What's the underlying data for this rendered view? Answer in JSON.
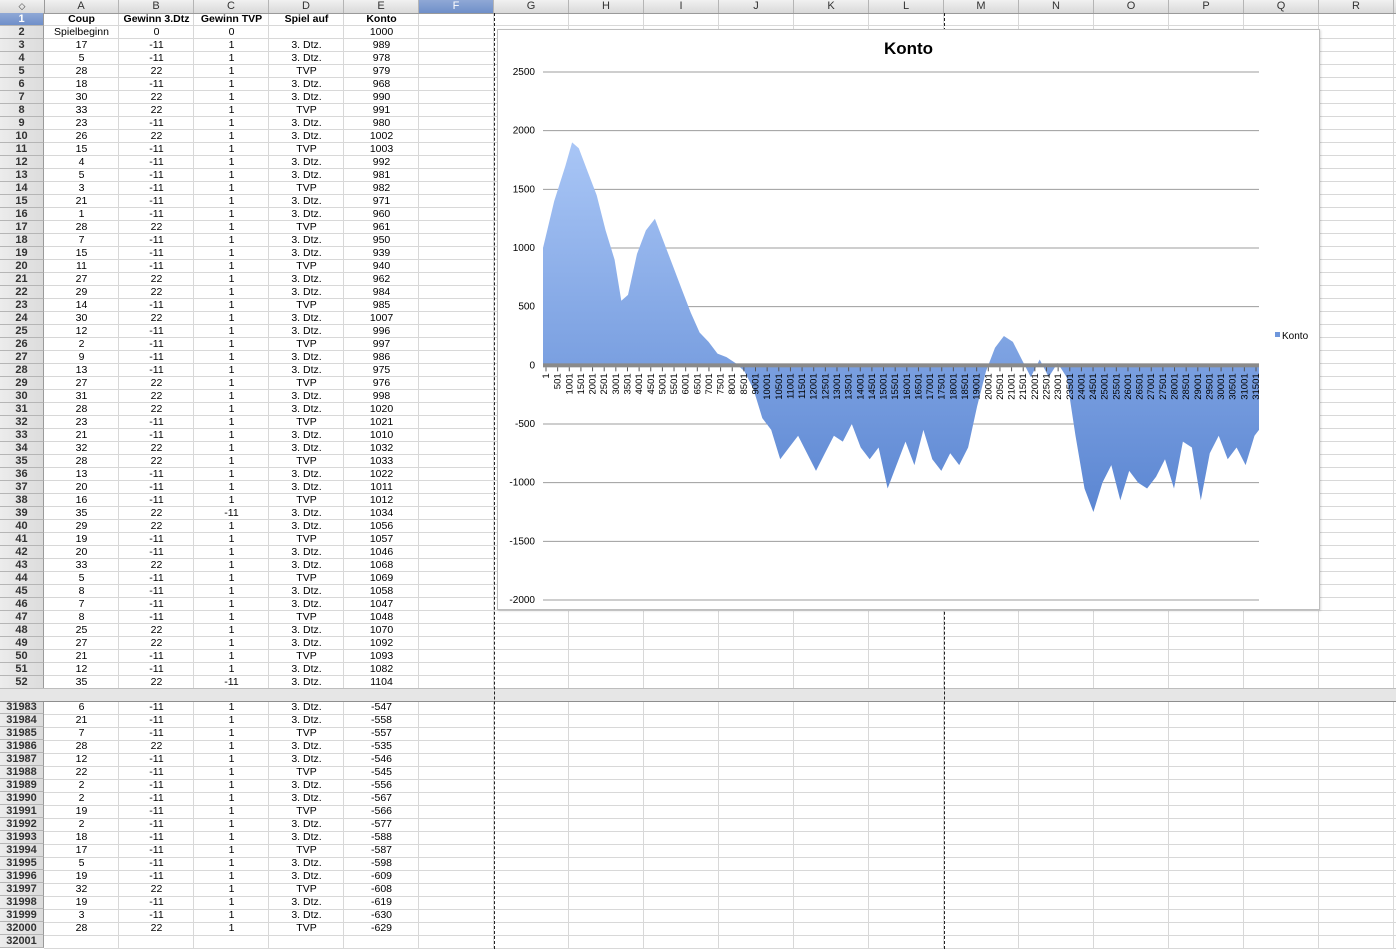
{
  "corner_symbol": "◇",
  "columns": [
    "A",
    "B",
    "C",
    "D",
    "E",
    "F",
    "G",
    "H",
    "I",
    "J",
    "K",
    "L",
    "M",
    "N",
    "O",
    "P",
    "Q",
    "R"
  ],
  "selected_column": "F",
  "header_row": {
    "row": "1",
    "cells": [
      "Coup",
      "Gewinn 3.Dtz",
      "Gewinn TVP",
      "Spiel auf",
      "Konto"
    ]
  },
  "rows_top": [
    {
      "row": "2",
      "cells": [
        "Spielbeginn",
        "0",
        "0",
        "",
        "1000"
      ]
    },
    {
      "row": "3",
      "cells": [
        "17",
        "-11",
        "1",
        "3. Dtz.",
        "989"
      ]
    },
    {
      "row": "4",
      "cells": [
        "5",
        "-11",
        "1",
        "3. Dtz.",
        "978"
      ]
    },
    {
      "row": "5",
      "cells": [
        "28",
        "22",
        "1",
        "TVP",
        "979"
      ]
    },
    {
      "row": "6",
      "cells": [
        "18",
        "-11",
        "1",
        "3. Dtz.",
        "968"
      ]
    },
    {
      "row": "7",
      "cells": [
        "30",
        "22",
        "1",
        "3. Dtz.",
        "990"
      ]
    },
    {
      "row": "8",
      "cells": [
        "33",
        "22",
        "1",
        "TVP",
        "991"
      ]
    },
    {
      "row": "9",
      "cells": [
        "23",
        "-11",
        "1",
        "3. Dtz.",
        "980"
      ]
    },
    {
      "row": "10",
      "cells": [
        "26",
        "22",
        "1",
        "3. Dtz.",
        "1002"
      ]
    },
    {
      "row": "11",
      "cells": [
        "15",
        "-11",
        "1",
        "TVP",
        "1003"
      ]
    },
    {
      "row": "12",
      "cells": [
        "4",
        "-11",
        "1",
        "3. Dtz.",
        "992"
      ]
    },
    {
      "row": "13",
      "cells": [
        "5",
        "-11",
        "1",
        "3. Dtz.",
        "981"
      ]
    },
    {
      "row": "14",
      "cells": [
        "3",
        "-11",
        "1",
        "TVP",
        "982"
      ]
    },
    {
      "row": "15",
      "cells": [
        "21",
        "-11",
        "1",
        "3. Dtz.",
        "971"
      ]
    },
    {
      "row": "16",
      "cells": [
        "1",
        "-11",
        "1",
        "3. Dtz.",
        "960"
      ]
    },
    {
      "row": "17",
      "cells": [
        "28",
        "22",
        "1",
        "TVP",
        "961"
      ]
    },
    {
      "row": "18",
      "cells": [
        "7",
        "-11",
        "1",
        "3. Dtz.",
        "950"
      ]
    },
    {
      "row": "19",
      "cells": [
        "15",
        "-11",
        "1",
        "3. Dtz.",
        "939"
      ]
    },
    {
      "row": "20",
      "cells": [
        "11",
        "-11",
        "1",
        "TVP",
        "940"
      ]
    },
    {
      "row": "21",
      "cells": [
        "27",
        "22",
        "1",
        "3. Dtz.",
        "962"
      ]
    },
    {
      "row": "22",
      "cells": [
        "29",
        "22",
        "1",
        "3. Dtz.",
        "984"
      ]
    },
    {
      "row": "23",
      "cells": [
        "14",
        "-11",
        "1",
        "TVP",
        "985"
      ]
    },
    {
      "row": "24",
      "cells": [
        "30",
        "22",
        "1",
        "3. Dtz.",
        "1007"
      ]
    },
    {
      "row": "25",
      "cells": [
        "12",
        "-11",
        "1",
        "3. Dtz.",
        "996"
      ]
    },
    {
      "row": "26",
      "cells": [
        "2",
        "-11",
        "1",
        "TVP",
        "997"
      ]
    },
    {
      "row": "27",
      "cells": [
        "9",
        "-11",
        "1",
        "3. Dtz.",
        "986"
      ]
    },
    {
      "row": "28",
      "cells": [
        "13",
        "-11",
        "1",
        "3. Dtz.",
        "975"
      ]
    },
    {
      "row": "29",
      "cells": [
        "27",
        "22",
        "1",
        "TVP",
        "976"
      ]
    },
    {
      "row": "30",
      "cells": [
        "31",
        "22",
        "1",
        "3. Dtz.",
        "998"
      ]
    },
    {
      "row": "31",
      "cells": [
        "28",
        "22",
        "1",
        "3. Dtz.",
        "1020"
      ]
    },
    {
      "row": "32",
      "cells": [
        "23",
        "-11",
        "1",
        "TVP",
        "1021"
      ]
    },
    {
      "row": "33",
      "cells": [
        "21",
        "-11",
        "1",
        "3. Dtz.",
        "1010"
      ]
    },
    {
      "row": "34",
      "cells": [
        "32",
        "22",
        "1",
        "3. Dtz.",
        "1032"
      ]
    },
    {
      "row": "35",
      "cells": [
        "28",
        "22",
        "1",
        "TVP",
        "1033"
      ]
    },
    {
      "row": "36",
      "cells": [
        "13",
        "-11",
        "1",
        "3. Dtz.",
        "1022"
      ]
    },
    {
      "row": "37",
      "cells": [
        "20",
        "-11",
        "1",
        "3. Dtz.",
        "1011"
      ]
    },
    {
      "row": "38",
      "cells": [
        "16",
        "-11",
        "1",
        "TVP",
        "1012"
      ]
    },
    {
      "row": "39",
      "cells": [
        "35",
        "22",
        "-11",
        "3. Dtz.",
        "1034"
      ]
    },
    {
      "row": "40",
      "cells": [
        "29",
        "22",
        "1",
        "3. Dtz.",
        "1056"
      ]
    },
    {
      "row": "41",
      "cells": [
        "19",
        "-11",
        "1",
        "TVP",
        "1057"
      ]
    },
    {
      "row": "42",
      "cells": [
        "20",
        "-11",
        "1",
        "3. Dtz.",
        "1046"
      ]
    },
    {
      "row": "43",
      "cells": [
        "33",
        "22",
        "1",
        "3. Dtz.",
        "1068"
      ]
    },
    {
      "row": "44",
      "cells": [
        "5",
        "-11",
        "1",
        "TVP",
        "1069"
      ]
    },
    {
      "row": "45",
      "cells": [
        "8",
        "-11",
        "1",
        "3. Dtz.",
        "1058"
      ]
    },
    {
      "row": "46",
      "cells": [
        "7",
        "-11",
        "1",
        "3. Dtz.",
        "1047"
      ]
    },
    {
      "row": "47",
      "cells": [
        "8",
        "-11",
        "1",
        "TVP",
        "1048"
      ]
    },
    {
      "row": "48",
      "cells": [
        "25",
        "22",
        "1",
        "3. Dtz.",
        "1070"
      ]
    },
    {
      "row": "49",
      "cells": [
        "27",
        "22",
        "1",
        "3. Dtz.",
        "1092"
      ]
    },
    {
      "row": "50",
      "cells": [
        "21",
        "-11",
        "1",
        "TVP",
        "1093"
      ]
    },
    {
      "row": "51",
      "cells": [
        "12",
        "-11",
        "1",
        "3. Dtz.",
        "1082"
      ]
    },
    {
      "row": "52",
      "cells": [
        "35",
        "22",
        "-11",
        "3. Dtz.",
        "1104"
      ]
    }
  ],
  "rows_bottom": [
    {
      "row": "31983",
      "cells": [
        "6",
        "-11",
        "1",
        "3. Dtz.",
        "-547"
      ]
    },
    {
      "row": "31984",
      "cells": [
        "21",
        "-11",
        "1",
        "3. Dtz.",
        "-558"
      ]
    },
    {
      "row": "31985",
      "cells": [
        "7",
        "-11",
        "1",
        "TVP",
        "-557"
      ]
    },
    {
      "row": "31986",
      "cells": [
        "28",
        "22",
        "1",
        "3. Dtz.",
        "-535"
      ]
    },
    {
      "row": "31987",
      "cells": [
        "12",
        "-11",
        "1",
        "3. Dtz.",
        "-546"
      ]
    },
    {
      "row": "31988",
      "cells": [
        "22",
        "-11",
        "1",
        "TVP",
        "-545"
      ]
    },
    {
      "row": "31989",
      "cells": [
        "2",
        "-11",
        "1",
        "3. Dtz.",
        "-556"
      ]
    },
    {
      "row": "31990",
      "cells": [
        "2",
        "-11",
        "1",
        "3. Dtz.",
        "-567"
      ]
    },
    {
      "row": "31991",
      "cells": [
        "19",
        "-11",
        "1",
        "TVP",
        "-566"
      ]
    },
    {
      "row": "31992",
      "cells": [
        "2",
        "-11",
        "1",
        "3. Dtz.",
        "-577"
      ]
    },
    {
      "row": "31993",
      "cells": [
        "18",
        "-11",
        "1",
        "3. Dtz.",
        "-588"
      ]
    },
    {
      "row": "31994",
      "cells": [
        "17",
        "-11",
        "1",
        "TVP",
        "-587"
      ]
    },
    {
      "row": "31995",
      "cells": [
        "5",
        "-11",
        "1",
        "3. Dtz.",
        "-598"
      ]
    },
    {
      "row": "31996",
      "cells": [
        "19",
        "-11",
        "1",
        "3. Dtz.",
        "-609"
      ]
    },
    {
      "row": "31997",
      "cells": [
        "32",
        "22",
        "1",
        "TVP",
        "-608"
      ]
    },
    {
      "row": "31998",
      "cells": [
        "19",
        "-11",
        "1",
        "3. Dtz.",
        "-619"
      ]
    },
    {
      "row": "31999",
      "cells": [
        "3",
        "-11",
        "1",
        "3. Dtz.",
        "-630"
      ]
    },
    {
      "row": "32000",
      "cells": [
        "28",
        "22",
        "1",
        "TVP",
        "-629"
      ]
    },
    {
      "row": "32001",
      "cells": [
        "",
        "",
        "",
        "",
        ""
      ]
    }
  ],
  "chart_data": {
    "type": "area",
    "title": "Konto",
    "legend": [
      "Konto"
    ],
    "legend_position": "right",
    "series_color": "#6f97dc",
    "ylim": [
      -2000,
      2500
    ],
    "yticks": [
      2500,
      2000,
      1500,
      1000,
      500,
      0,
      -500,
      -1000,
      -1500,
      -2000
    ],
    "xtick_labels": [
      "1",
      "501",
      "1001",
      "1501",
      "2001",
      "2501",
      "3001",
      "3501",
      "4001",
      "4501",
      "5001",
      "5501",
      "6001",
      "6501",
      "7001",
      "7501",
      "8001",
      "8501",
      "9001",
      "10001",
      "10501",
      "11001",
      "11501",
      "12001",
      "12501",
      "13001",
      "13501",
      "14001",
      "14501",
      "15001",
      "15501",
      "16001",
      "16501",
      "17001",
      "17501",
      "18001",
      "18501",
      "19001",
      "20001",
      "20501",
      "21001",
      "21501",
      "22001",
      "22501",
      "23001",
      "23501",
      "24001",
      "24501",
      "25001",
      "25501",
      "26001",
      "26501",
      "27001",
      "27501",
      "28001",
      "28501",
      "29001",
      "29501",
      "30001",
      "30501",
      "31001",
      "31501"
    ],
    "series": [
      {
        "name": "Konto",
        "x": [
          1,
          500,
          1000,
          1300,
          1600,
          2000,
          2400,
          2800,
          3200,
          3500,
          3800,
          4200,
          4600,
          5000,
          5400,
          5800,
          6200,
          6600,
          7000,
          7400,
          7800,
          8200,
          8600,
          9000,
          9400,
          9800,
          10200,
          10600,
          11000,
          11400,
          11800,
          12200,
          12600,
          13000,
          13400,
          13800,
          14200,
          14600,
          15000,
          15400,
          15800,
          16200,
          16600,
          17000,
          17400,
          17800,
          18200,
          18600,
          19000,
          19400,
          19800,
          20200,
          20600,
          21000,
          21400,
          21800,
          22200,
          22600,
          23000,
          23400,
          23800,
          24200,
          24600,
          25000,
          25400,
          25800,
          26200,
          26600,
          27000,
          27400,
          27800,
          28200,
          28600,
          29000,
          29400,
          29800,
          30200,
          30600,
          31000,
          31400,
          31800,
          32000
        ],
        "values": [
          1000,
          1400,
          1700,
          1900,
          1850,
          1650,
          1450,
          1150,
          900,
          550,
          600,
          950,
          1150,
          1250,
          1050,
          850,
          650,
          450,
          280,
          200,
          100,
          70,
          20,
          -50,
          -200,
          -450,
          -550,
          -800,
          -700,
          -600,
          -750,
          -900,
          -750,
          -600,
          -650,
          -500,
          -700,
          -800,
          -700,
          -1050,
          -850,
          -650,
          -850,
          -550,
          -800,
          -900,
          -750,
          -850,
          -700,
          -350,
          -50,
          150,
          250,
          200,
          50,
          -100,
          50,
          -100,
          20,
          -100,
          -600,
          -1050,
          -1250,
          -1000,
          -850,
          -1150,
          -900,
          -1000,
          -1050,
          -950,
          -800,
          -1050,
          -650,
          -700,
          -1150,
          -750,
          -600,
          -800,
          -700,
          -850,
          -600,
          -550
        ]
      }
    ]
  }
}
